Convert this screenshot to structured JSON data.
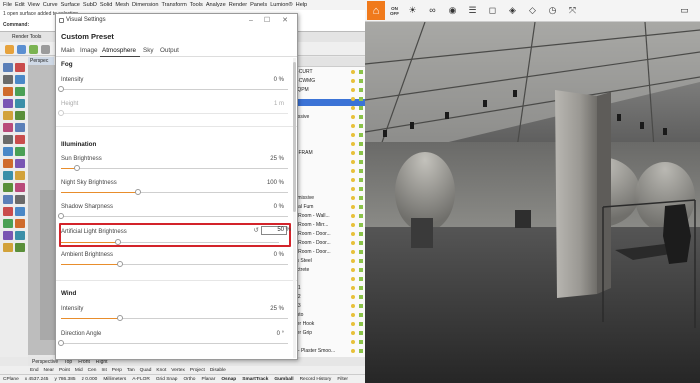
{
  "rhino": {
    "menu": [
      "File",
      "Edit",
      "View",
      "Curve",
      "Surface",
      "SubD",
      "Solid",
      "Mesh",
      "Dimension",
      "Transform",
      "Tools",
      "Analyze",
      "Render",
      "Panels",
      "Lumion®",
      "Help"
    ],
    "command_history": "1 open surface added to selection.",
    "command_label": "Command:",
    "toolbar_tab": "Render Tools",
    "viewport_label": "Perspec",
    "layers": [
      "Z-CURT",
      "Z-CWMG",
      "EQPM",
      "",
      "",
      "nissive",
      "",
      "",
      "",
      "n-FRAM",
      "",
      "",
      "",
      "",
      "Emissive",
      "mal Fum",
      "g Room - Wall...",
      "g Room - Mirr...",
      "g Room - Door...",
      "g Room - Door...",
      "g Room - Door...",
      "ss Steel",
      "nctrete",
      "",
      "c 1",
      "c 2",
      "c 3",
      "nsto",
      "ger Hook",
      "ger Grip",
      "",
      "c - Plaster Smoo..."
    ],
    "viewport_tabs": [
      "Perspective",
      "Top",
      "Front",
      "Right"
    ],
    "osnaps": [
      "End",
      "Near",
      "Point",
      "Mid",
      "Cen",
      "Int",
      "Perp",
      "Tan",
      "Quad",
      "Knot",
      "Vertex",
      "Project",
      "Disable"
    ],
    "status": [
      "CPlane",
      "x 4537.245",
      "y 786.385",
      "z 0.000",
      "Millimeters",
      "A-FLOR",
      "Grid Snap",
      "Ortho",
      "Planar",
      "Osnap",
      "SmartTrack",
      "Gumball",
      "Record History",
      "Filter"
    ]
  },
  "dialog": {
    "title": "Visual Settings",
    "preset": "Custom Preset",
    "tabs": [
      "Main",
      "Image",
      "Atmosphere",
      "Sky",
      "Output"
    ],
    "active_tab": "Atmosphere",
    "sections": {
      "fog": "Fog",
      "illumination": "Illumination",
      "wind": "Wind"
    },
    "params": {
      "fog_intensity": {
        "label": "Intensity",
        "value": "0",
        "unit": "%",
        "fraction": 0.0
      },
      "fog_height": {
        "label": "Height",
        "value": "1",
        "unit": "m",
        "fraction": 0.0
      },
      "sun_brightness": {
        "label": "Sun Brightness",
        "value": "25",
        "unit": "%",
        "fraction": 0.07
      },
      "night_sky": {
        "label": "Night Sky Brightness",
        "value": "100",
        "unit": "%",
        "fraction": 0.34
      },
      "shadow_sharpness": {
        "label": "Shadow Sharpness",
        "value": "0",
        "unit": "%",
        "fraction": 0.0
      },
      "artificial_light": {
        "label": "Artificial Light Brightness",
        "value": "50",
        "unit": "%",
        "fraction": 0.26
      },
      "ambient": {
        "label": "Ambient Brightness",
        "value": "0",
        "unit": "%",
        "fraction": 0.26
      },
      "wind_intensity": {
        "label": "Intensity",
        "value": "25",
        "unit": "%",
        "fraction": 0.26
      },
      "direction_angle": {
        "label": "Direction Angle",
        "value": "0",
        "unit": "°",
        "fraction": 0.0
      }
    }
  },
  "colors": {
    "accent": "#e88d2c",
    "highlight": "#d3232a",
    "lumion_home": "#f07a1c",
    "layer_selected": "#3b73d6"
  },
  "lumion_toolbar_icons": [
    "home-icon",
    "toggle-on-icon",
    "sun-icon",
    "binoculars-icon",
    "eye-icon",
    "sliders-icon",
    "cube-outline-icon",
    "box-3d-icon",
    "cube-cut-icon",
    "clock-icon",
    "transform-icon",
    "folder-icon"
  ],
  "lumion_toolbar_text": {
    "left": "ON",
    "right": "OFF"
  }
}
